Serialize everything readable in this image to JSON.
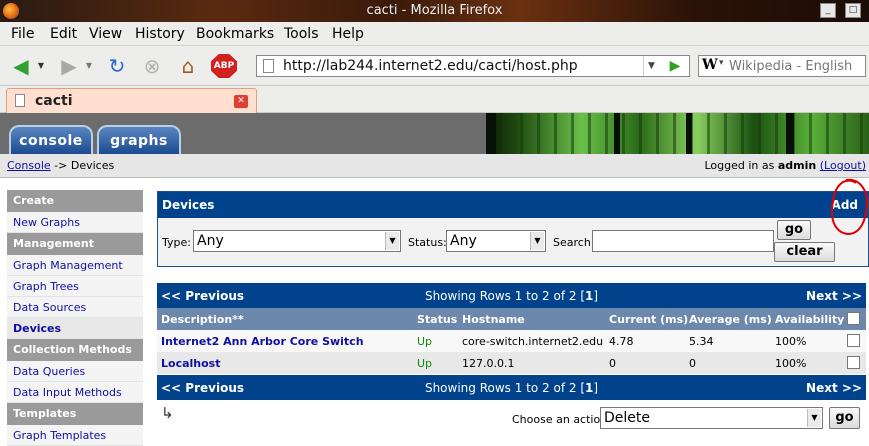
{
  "window": {
    "title": "cacti - Mozilla Firefox"
  },
  "menu": [
    "File",
    "Edit",
    "View",
    "History",
    "Bookmarks",
    "Tools",
    "Help"
  ],
  "nav": {
    "url": "http://lab244.internet2.edu/cacti/host.php",
    "search_placeholder": "Wikipedia - English",
    "search_engine_letter": "W"
  },
  "tab": {
    "label": "cacti"
  },
  "cacti_tabs": [
    "console",
    "graphs"
  ],
  "breadcrumb": {
    "console": "Console",
    "separator": "->",
    "current": "Devices"
  },
  "login": {
    "prefix": "Logged in as",
    "user": "admin",
    "logout": "(Logout)"
  },
  "sidebar": [
    {
      "type": "head",
      "label": "Create"
    },
    {
      "type": "item",
      "label": "New Graphs"
    },
    {
      "type": "head",
      "label": "Management"
    },
    {
      "type": "item",
      "label": "Graph Management"
    },
    {
      "type": "item",
      "label": "Graph Trees"
    },
    {
      "type": "item",
      "label": "Data Sources"
    },
    {
      "type": "item",
      "label": "Devices",
      "active": true
    },
    {
      "type": "head",
      "label": "Collection Methods"
    },
    {
      "type": "item",
      "label": "Data Queries"
    },
    {
      "type": "item",
      "label": "Data Input Methods"
    },
    {
      "type": "head",
      "label": "Templates"
    },
    {
      "type": "item",
      "label": "Graph Templates"
    }
  ],
  "filter": {
    "title": "Devices",
    "add_label": "Add",
    "type_label": "Type:",
    "type_value": "Any",
    "status_label": "Status:",
    "status_value": "Any",
    "search_label": "Search:",
    "search_value": "",
    "go_label": "go",
    "clear_label": "clear"
  },
  "list": {
    "prev_label": "<< Previous",
    "next_label": "Next >>",
    "showing_prefix": "Showing Rows 1 to 2 of 2 [",
    "showing_page": "1",
    "showing_suffix": "]",
    "columns": [
      "Description**",
      "Status",
      "Hostname",
      "Current (ms)",
      "Average (ms)",
      "Availability"
    ],
    "rows": [
      {
        "description": "Internet2 Ann Arbor Core Switch",
        "status": "Up",
        "hostname": "core-switch.internet2.edu",
        "current": "4.78",
        "average": "5.34",
        "availability": "100%"
      },
      {
        "description": "Localhost",
        "status": "Up",
        "hostname": "127.0.0.1",
        "current": "0",
        "average": "0",
        "availability": "100%"
      }
    ]
  },
  "actions": {
    "label": "Choose an action:",
    "value": "Delete",
    "go_label": "go"
  },
  "colors": {
    "header_blue": "#00438c",
    "column_header": "#6d88ad",
    "status_up": "#118811",
    "annotation_red": "#e00000"
  }
}
